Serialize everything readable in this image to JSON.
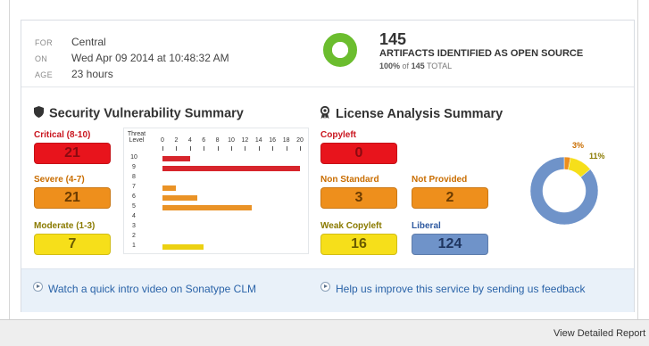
{
  "meta": {
    "for_label": "FOR",
    "for_value": "Central",
    "on_label": "ON",
    "on_value": "Wed Apr 09 2014 at 10:48:32 AM",
    "age_label": "AGE",
    "age_value": "23 hours"
  },
  "artifacts": {
    "count": "145",
    "title": "ARTIFACTS IDENTIFIED AS OPEN SOURCE",
    "percent": "100%",
    "of_text": "of",
    "total_count": "145",
    "total_label": "TOTAL",
    "open_source_fraction": 1.0,
    "ring_color": "#6bbd2e"
  },
  "security": {
    "title": "Security Vulnerability Summary",
    "icon": "shield-icon",
    "critical": {
      "label": "Critical (8-10)",
      "value": "21",
      "color": "#e8141c"
    },
    "severe": {
      "label": "Severe (4-7)",
      "value": "21",
      "color": "#ee8f1c"
    },
    "moderate": {
      "label": "Moderate (1-3)",
      "value": "7",
      "color": "#f6df1a"
    }
  },
  "chart_data": {
    "type": "bar",
    "orientation": "horizontal",
    "title": "",
    "ylabel": "Threat Level",
    "xticks": [
      "0",
      "2",
      "4",
      "6",
      "8",
      "10",
      "12",
      "14",
      "16",
      "18",
      "20"
    ],
    "xlim": [
      0,
      20
    ],
    "categories": [
      "10",
      "9",
      "8",
      "7",
      "6",
      "5",
      "4",
      "3",
      "2",
      "1"
    ],
    "values": [
      4,
      20,
      0,
      2,
      5,
      13,
      0,
      0,
      0,
      6
    ],
    "colors": [
      "#d7252c",
      "#d7252c",
      "#d7252c",
      "#ea9326",
      "#ea9326",
      "#ea9326",
      "#ea9326",
      "#ecd112",
      "#ecd112",
      "#ecd112"
    ]
  },
  "license": {
    "title": "License Analysis Summary",
    "icon": "ribbon-icon",
    "copyleft": {
      "label": "Copyleft",
      "value": "0"
    },
    "non_standard": {
      "label": "Non Standard",
      "value": "3"
    },
    "not_provided": {
      "label": "Not Provided",
      "value": "2"
    },
    "weak_copyleft": {
      "label": "Weak Copyleft",
      "value": "16"
    },
    "liberal": {
      "label": "Liberal",
      "value": "124"
    },
    "pie": {
      "type": "pie",
      "slices": [
        {
          "value": 3,
          "label": "3%",
          "color": "#ee8f1c"
        },
        {
          "value": 11,
          "label": "11%",
          "color": "#f6df1a"
        },
        {
          "value": 86,
          "label": "",
          "color": "#6f93c9"
        }
      ]
    }
  },
  "footer": {
    "video_link": "Watch a quick intro video on Sonatype CLM",
    "feedback_link": "Help us improve this service by sending us feedback"
  },
  "bottom": {
    "view_report": "View Detailed Report"
  }
}
